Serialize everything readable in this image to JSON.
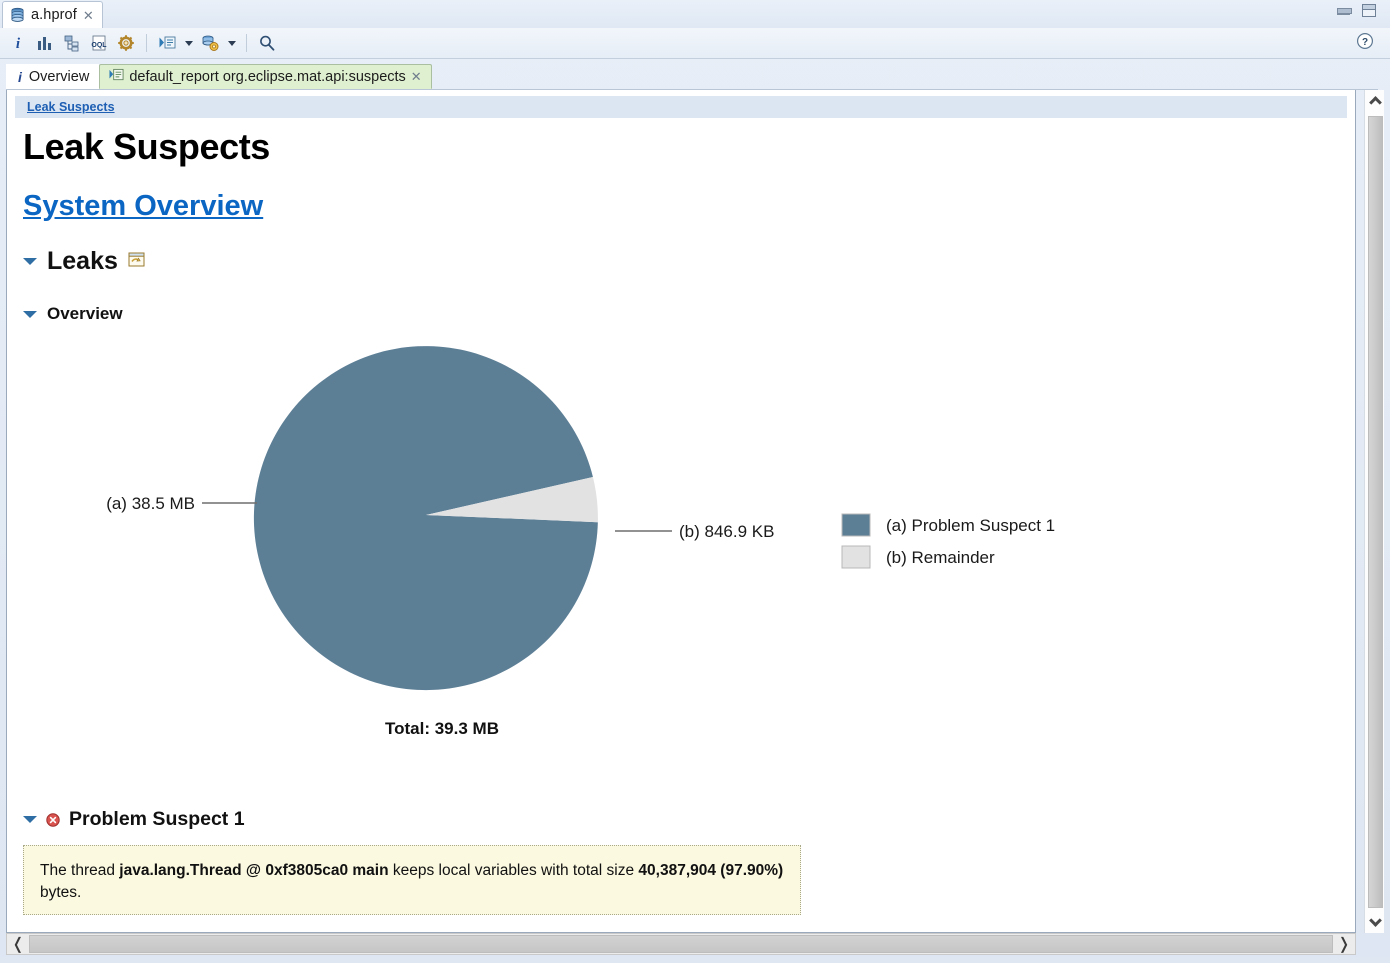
{
  "window": {
    "editor_tab_label": "a.hprof",
    "editor_tab_icon": "heap-dump-icon",
    "close_icon": "✕",
    "minimize_label": "minimize-icon",
    "maximize_label": "maximize-icon"
  },
  "toolbar": {
    "buttons": [
      {
        "name": "overview-info-icon",
        "label": "i"
      },
      {
        "name": "histogram-icon",
        "label": ""
      },
      {
        "name": "dominator-tree-icon",
        "label": ""
      },
      {
        "name": "oql-icon",
        "label": "OQL"
      },
      {
        "name": "run-expert-system-test-icon",
        "label": ""
      },
      {
        "name": "open-query-browser-icon",
        "label": ""
      },
      {
        "name": "open-query-browser-arrow",
        "label": ""
      },
      {
        "name": "heap-dump-actions-icon",
        "label": ""
      },
      {
        "name": "heap-dump-actions-arrow",
        "label": ""
      },
      {
        "name": "search-icon",
        "label": ""
      }
    ],
    "help_icon": "?"
  },
  "view_tabs": [
    {
      "label": "Overview",
      "icon": "info-icon",
      "active": false
    },
    {
      "label": "default_report  org.eclipse.mat.api:suspects",
      "icon": "report-icon",
      "active": true,
      "closable": true
    }
  ],
  "report": {
    "breadcrumb": "Leak Suspects",
    "title": "Leak Suspects",
    "system_overview_link": "System Overview",
    "sections": {
      "leaks": {
        "heading": "Leaks",
        "icon": "report-window-icon",
        "expanded": true
      },
      "overview": {
        "heading": "Overview",
        "expanded": true
      },
      "problem_suspect": {
        "heading": "Problem Suspect 1",
        "icon": "error-icon",
        "expanded": true,
        "description_parts": [
          {
            "text": "The thread ",
            "bold": false
          },
          {
            "text": "java.lang.Thread @ 0xf3805ca0 main",
            "bold": true
          },
          {
            "text": " keeps local variables with total size ",
            "bold": false
          },
          {
            "text": "40,387,904 (97.90%)",
            "bold": true
          },
          {
            "text": " bytes.",
            "bold": false
          }
        ],
        "description_line1": "The thread java.lang.Thread @ 0xf3805ca0 main keeps local variables with total size",
        "description_line2": "40,387,904 (97.90%) bytes."
      }
    }
  },
  "chart_data": {
    "type": "pie",
    "title": "",
    "total_label": "Total: 39.3 MB",
    "total_bytes": 41254000,
    "legend_position": "right",
    "categories": [
      "Problem Suspect 1",
      "Remainder"
    ],
    "keys": [
      "(a)",
      "(b)"
    ],
    "values": [
      40387904,
      866714
    ],
    "percentages": [
      97.9,
      2.1
    ],
    "value_labels": [
      "38.5 MB",
      "846.9 KB"
    ],
    "callout_labels": [
      "(a)  38.5 MB",
      "(b)  846.9 KB"
    ],
    "legend_labels": [
      "(a)   Problem Suspect 1",
      "(b)   Remainder"
    ],
    "colors": [
      "#5d7f96",
      "#e0e0e0"
    ],
    "start_angle_deg": 0,
    "direction": "clockwise"
  },
  "scrollbars": {
    "vertical": {
      "up_icon": "chevron-up-icon",
      "down_icon": "chevron-down-icon"
    },
    "horizontal": {
      "left_icon": "chevron-left-icon",
      "right_icon": "chevron-right-icon",
      "left_glyph": "❬",
      "right_glyph": "❭"
    }
  }
}
